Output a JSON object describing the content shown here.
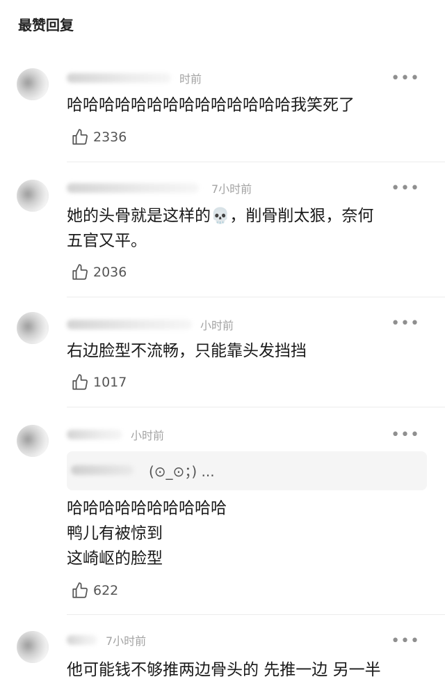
{
  "section_title": "最赞回复",
  "comments": [
    {
      "time": "时前",
      "text": "哈哈哈哈哈哈哈哈哈哈哈哈哈哈我笑死了",
      "likes": "2336"
    },
    {
      "time": "7小时前",
      "text_before_emoji": "她的头骨就是这样的",
      "emoji": "💀",
      "text_after_emoji": "，削骨削太狠，奈何\n五官又平。",
      "likes": "2036"
    },
    {
      "time": "小时前",
      "text": "右边脸型不流畅，只能靠头发挡挡",
      "likes": "1017"
    },
    {
      "time": "小时前",
      "quote": "(⊙_⊙；) ...",
      "text": "哈哈哈哈哈哈哈哈哈哈\n鸭儿有被惊到\n这崎岖的脸型",
      "likes": "622"
    },
    {
      "time": "7小时前",
      "text": "他可能钱不够推两边骨头的 先推一边 另一半"
    }
  ],
  "icons": {
    "more": "more-icon",
    "like": "thumb-up-icon"
  }
}
